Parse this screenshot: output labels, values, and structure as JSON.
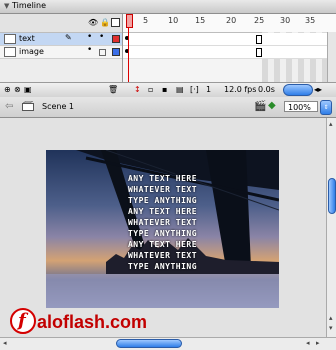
{
  "timeline": {
    "title": "Timeline",
    "layers": [
      {
        "name": "text",
        "selected": true,
        "color": "#e03030"
      },
      {
        "name": "image",
        "selected": false,
        "color": "#3a6ee8"
      }
    ],
    "ruler_numbers": [
      "5",
      "10",
      "15",
      "20",
      "25",
      "30",
      "35"
    ],
    "status": {
      "current_frame": "1",
      "frame_rate": "12.0 fps",
      "elapsed": "0.0s"
    }
  },
  "scene": {
    "name": "Scene 1",
    "zoom": "100%"
  },
  "stage": {
    "text_lines": [
      "ANY TEXT HERE",
      "WHATEVER TEXT",
      "TYPE ANYTHING",
      "ANY TEXT HERE",
      "WHATEVER TEXT",
      "TYPE ANYTHING",
      "ANY TEXT HERE",
      "WHATEVER TEXT",
      "TYPE ANYTHING"
    ]
  },
  "watermark": {
    "text": "aloflash.com",
    "color": "#c20000"
  }
}
